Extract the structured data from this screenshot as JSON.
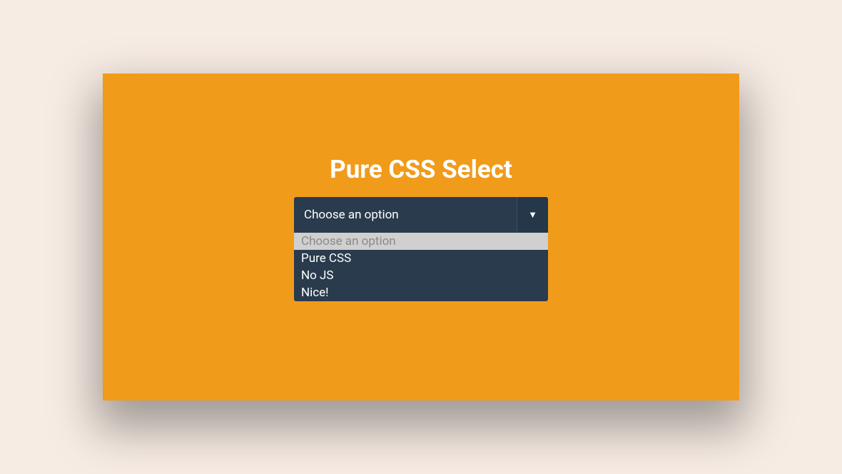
{
  "title": "Pure CSS Select",
  "select": {
    "selected": "Choose an option",
    "arrow": "▼",
    "options": [
      {
        "label": "Choose an option",
        "highlighted": true
      },
      {
        "label": "Pure CSS",
        "highlighted": false
      },
      {
        "label": "No JS",
        "highlighted": false
      },
      {
        "label": "Nice!",
        "highlighted": false
      }
    ]
  },
  "colors": {
    "background": "#f7ece4",
    "card": "#f19b1b",
    "select": "#2a3b4d",
    "selectArrow": "#24384a",
    "highlighted": "#d0d0d0"
  }
}
